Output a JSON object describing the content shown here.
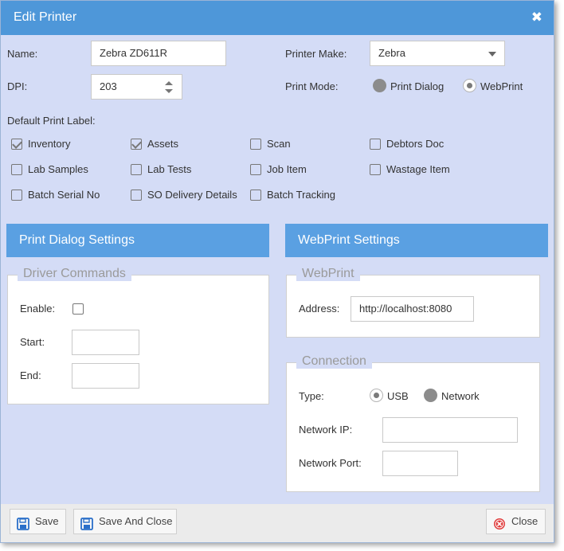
{
  "window": {
    "title": "Edit Printer",
    "close_glyph": "✖"
  },
  "form": {
    "name_label": "Name:",
    "name_value": "Zebra ZD611R",
    "dpi_label": "DPI:",
    "dpi_value": "203",
    "make_label": "Printer Make:",
    "make_value": "Zebra",
    "mode_label": "Print Mode:",
    "mode_options": [
      "Print Dialog",
      "WebPrint"
    ],
    "mode_selected": "WebPrint",
    "labels_heading": "Default Print Label:",
    "labels": [
      {
        "label": "Inventory",
        "checked": true
      },
      {
        "label": "Assets",
        "checked": true
      },
      {
        "label": "Scan",
        "checked": false
      },
      {
        "label": "Debtors Doc",
        "checked": false
      },
      {
        "label": "Lab Samples",
        "checked": false
      },
      {
        "label": "Lab Tests",
        "checked": false
      },
      {
        "label": "Job Item",
        "checked": false
      },
      {
        "label": "Wastage Item",
        "checked": false
      },
      {
        "label": "Batch Serial No",
        "checked": false
      },
      {
        "label": "SO Delivery Details",
        "checked": false
      },
      {
        "label": "Batch Tracking",
        "checked": false
      }
    ]
  },
  "print_dialog": {
    "header": "Print Dialog Settings",
    "legend": "Driver Commands",
    "enable_label": "Enable:",
    "enable_checked": false,
    "start_label": "Start:",
    "start_value": "",
    "end_label": "End:",
    "end_value": ""
  },
  "webprint": {
    "header": "WebPrint Settings",
    "legend": "WebPrint",
    "address_label": "Address:",
    "address_value": "http://localhost:8080",
    "connection_legend": "Connection",
    "type_label": "Type:",
    "type_options": [
      "USB",
      "Network"
    ],
    "type_selected": "USB",
    "ip_label": "Network IP:",
    "ip_value": "",
    "port_label": "Network Port:",
    "port_value": ""
  },
  "footer": {
    "save": "Save",
    "save_close": "Save And Close",
    "close": "Close"
  },
  "colors": {
    "title_bar": "#4e97d9",
    "section_header": "#5aa0e2",
    "dialog_bg": "#d4dcf6",
    "save_icon": "#2a6fc9",
    "close_icon": "#e03c3c"
  }
}
